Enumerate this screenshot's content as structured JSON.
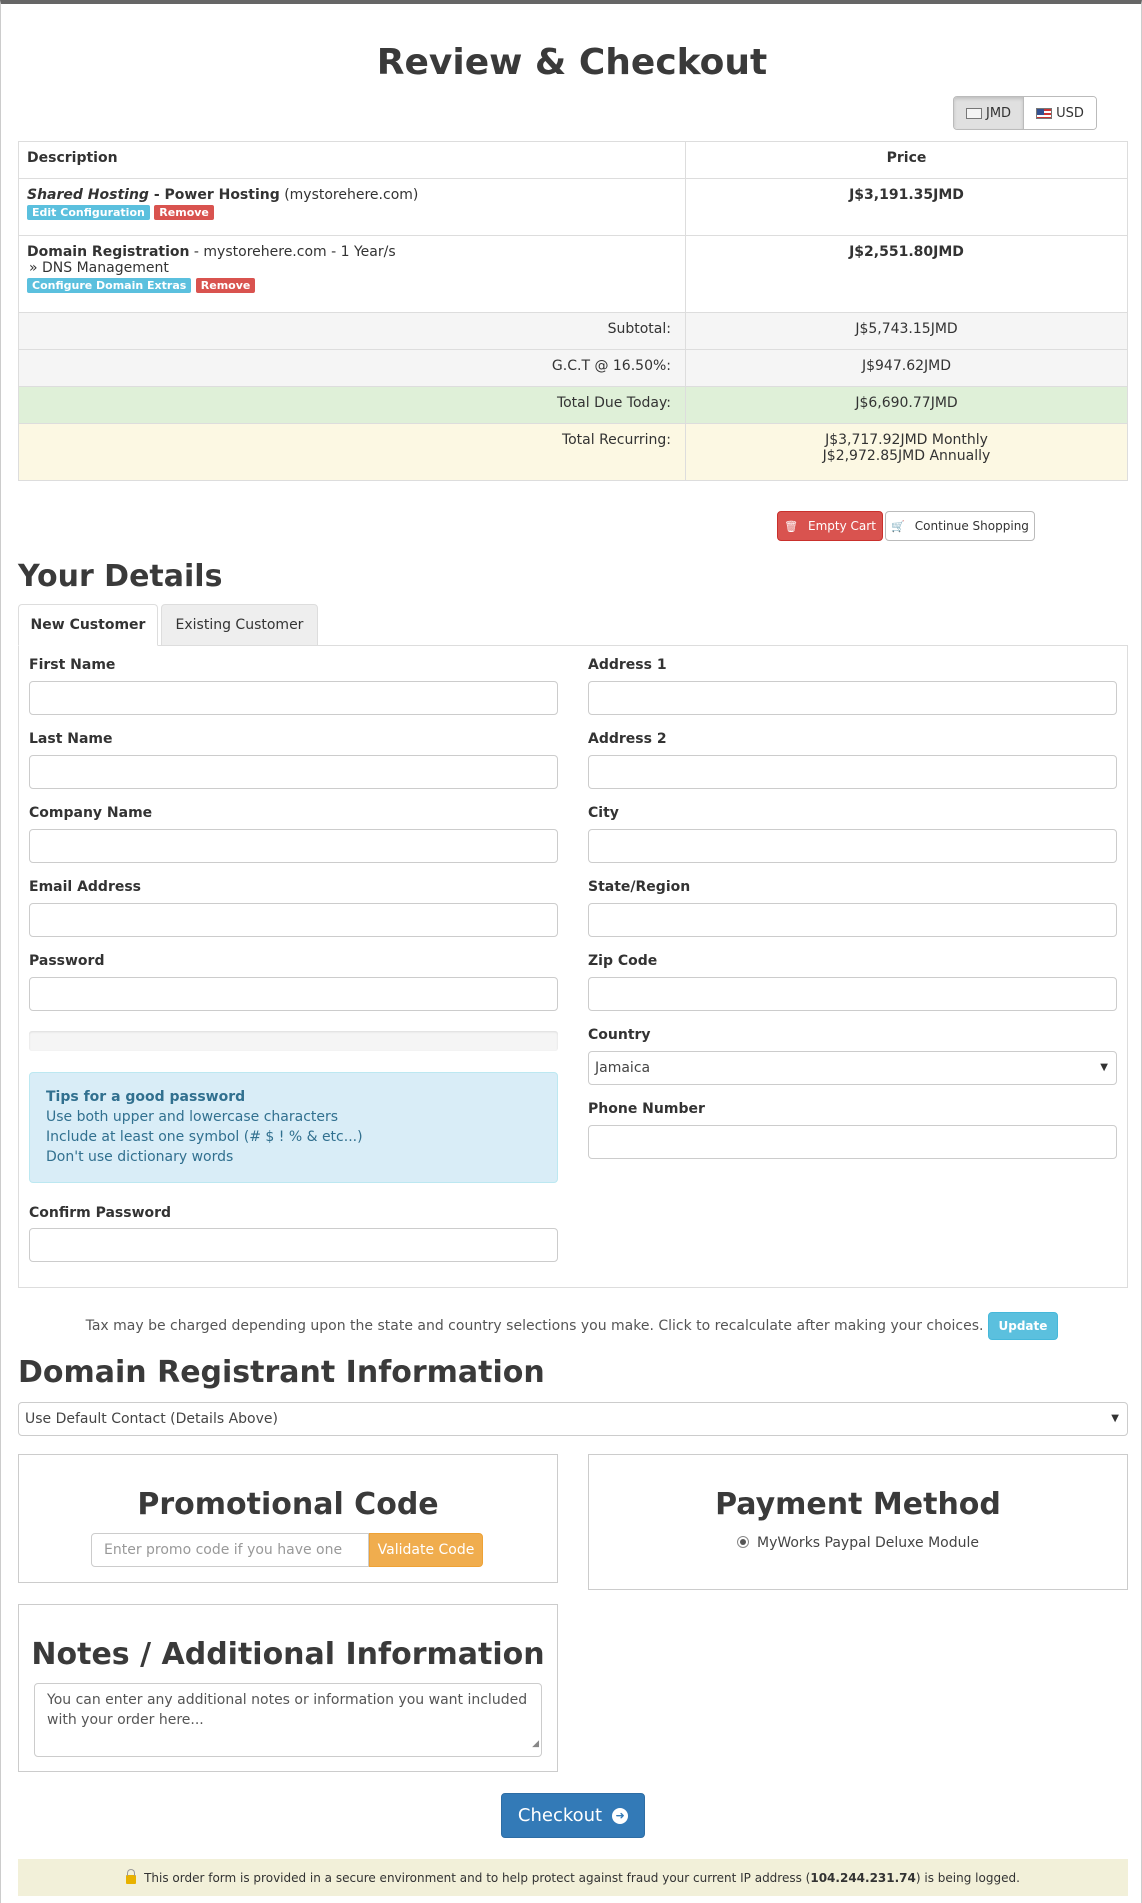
{
  "page_title": "Review & Checkout",
  "currency": {
    "options": [
      {
        "code": "JMD",
        "active": true
      },
      {
        "code": "USD",
        "active": false
      }
    ]
  },
  "cart": {
    "headers": {
      "description": "Description",
      "price": "Price"
    },
    "items": [
      {
        "category": "Shared Hosting",
        "separator": " - ",
        "product": "Power Hosting",
        "domain": " (mystorehere.com)",
        "price": "J$3,191.35JMD",
        "actions": {
          "primary": "Edit Configuration",
          "remove": "Remove"
        }
      },
      {
        "category": "Domain Registration",
        "details": " - mystorehere.com - 1 Year/s",
        "addon": "» DNS Management",
        "price": "J$2,551.80JMD",
        "actions": {
          "primary": "Configure Domain Extras",
          "remove": "Remove"
        }
      }
    ],
    "subtotal": {
      "label": "Subtotal:",
      "value": "J$5,743.15JMD"
    },
    "tax": {
      "label": "G.C.T @ 16.50%:",
      "value": "J$947.62JMD"
    },
    "total_due": {
      "label": "Total Due Today:",
      "value": "J$6,690.77JMD"
    },
    "total_recurring": {
      "label": "Total Recurring:",
      "monthly": "J$3,717.92JMD Monthly",
      "annually": "J$2,972.85JMD Annually"
    }
  },
  "cart_buttons": {
    "empty": "Empty Cart",
    "continue": "Continue Shopping"
  },
  "details": {
    "heading": "Your Details",
    "tabs": {
      "new": "New Customer",
      "existing": "Existing Customer"
    },
    "left_fields": {
      "first_name": "First Name",
      "last_name": "Last Name",
      "company": "Company Name",
      "email": "Email Address",
      "password": "Password",
      "confirm_password": "Confirm Password"
    },
    "right_fields": {
      "address1": "Address 1",
      "address2": "Address 2",
      "city": "City",
      "state": "State/Region",
      "zip": "Zip Code",
      "country": "Country",
      "country_value": "Jamaica",
      "phone": "Phone Number"
    },
    "tips": {
      "title": "Tips for a good password",
      "lines": [
        "Use both upper and lowercase characters",
        "Include at least one symbol (# $ ! % & etc...)",
        "Don't use dictionary words"
      ]
    }
  },
  "tax_note": {
    "text": "Tax may be charged depending upon the state and country selections you make. Click to recalculate after making your choices.",
    "button": "Update"
  },
  "registrant": {
    "heading": "Domain Registrant Information",
    "selected": "Use Default Contact (Details Above)"
  },
  "promo": {
    "heading": "Promotional Code",
    "placeholder": "Enter promo code if you have one",
    "button": "Validate Code"
  },
  "payment": {
    "heading": "Payment Method",
    "option": "MyWorks Paypal Deluxe Module"
  },
  "notes": {
    "heading": "Notes / Additional Information",
    "placeholder": "You can enter any additional notes or information you want included with your order here..."
  },
  "checkout_button": "Checkout",
  "secure_notice": {
    "before": "This order form is provided in a secure environment and to help protect against fraud your current IP address (",
    "ip": "104.244.231.74",
    "after": ") is being logged."
  }
}
